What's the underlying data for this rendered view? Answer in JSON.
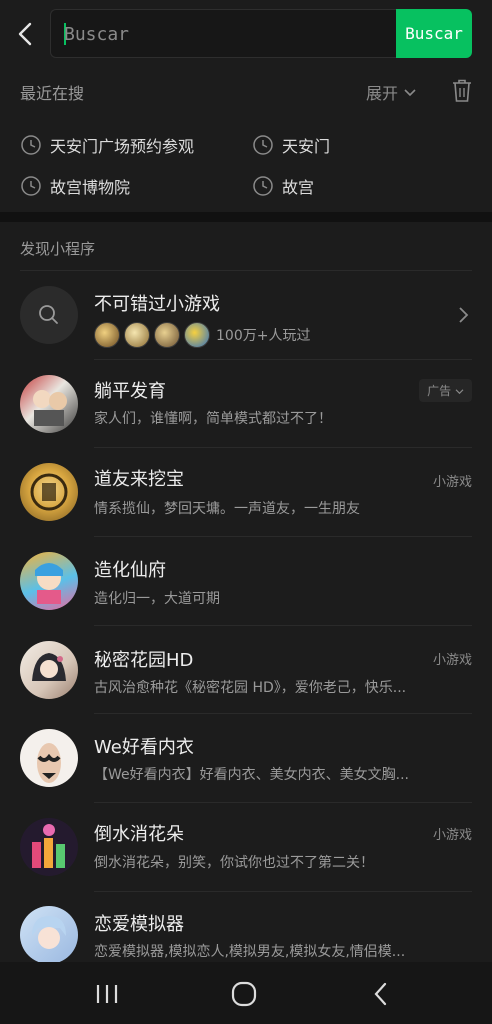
{
  "search": {
    "placeholder": "Buscar",
    "button_label": "Buscar"
  },
  "recent": {
    "title": "最近在搜",
    "expand_label": "展开",
    "items": [
      "天安门广场预约参观",
      "天安门",
      "故宫博物院",
      "故宫"
    ]
  },
  "miniprograms": {
    "title": "发现小程序",
    "games_banner": {
      "title": "不可错过小游戏",
      "players_text": "100万+人玩过"
    },
    "items": [
      {
        "name": "躺平发育",
        "desc": "家人们，谁懂啊，简单模式都过不了！",
        "tag": "广告"
      },
      {
        "name": "道友来挖宝",
        "desc": "情系揽仙，梦回天墉。一声道友，一生朋友",
        "tag": "小游戏"
      },
      {
        "name": "造化仙府",
        "desc": "造化归一，大道可期",
        "tag": ""
      },
      {
        "name": "秘密花园HD",
        "desc": "古风治愈种花《秘密花园 HD》，爱你老己，快乐...",
        "tag": "小游戏"
      },
      {
        "name": "We好看内衣",
        "desc": "【We好看内衣】好看内衣、美女内衣、美女文胸...",
        "tag": ""
      },
      {
        "name": "倒水消花朵",
        "desc": "倒水消花朵，别笑，你试你也过不了第二关！",
        "tag": "小游戏"
      },
      {
        "name": "恋爱模拟器",
        "desc": "恋爱模拟器,模拟恋人,模拟男友,模拟女友,情侣模...",
        "tag": ""
      }
    ]
  },
  "colors": {
    "accent": "#07c160",
    "background": "#1c1c1c"
  }
}
